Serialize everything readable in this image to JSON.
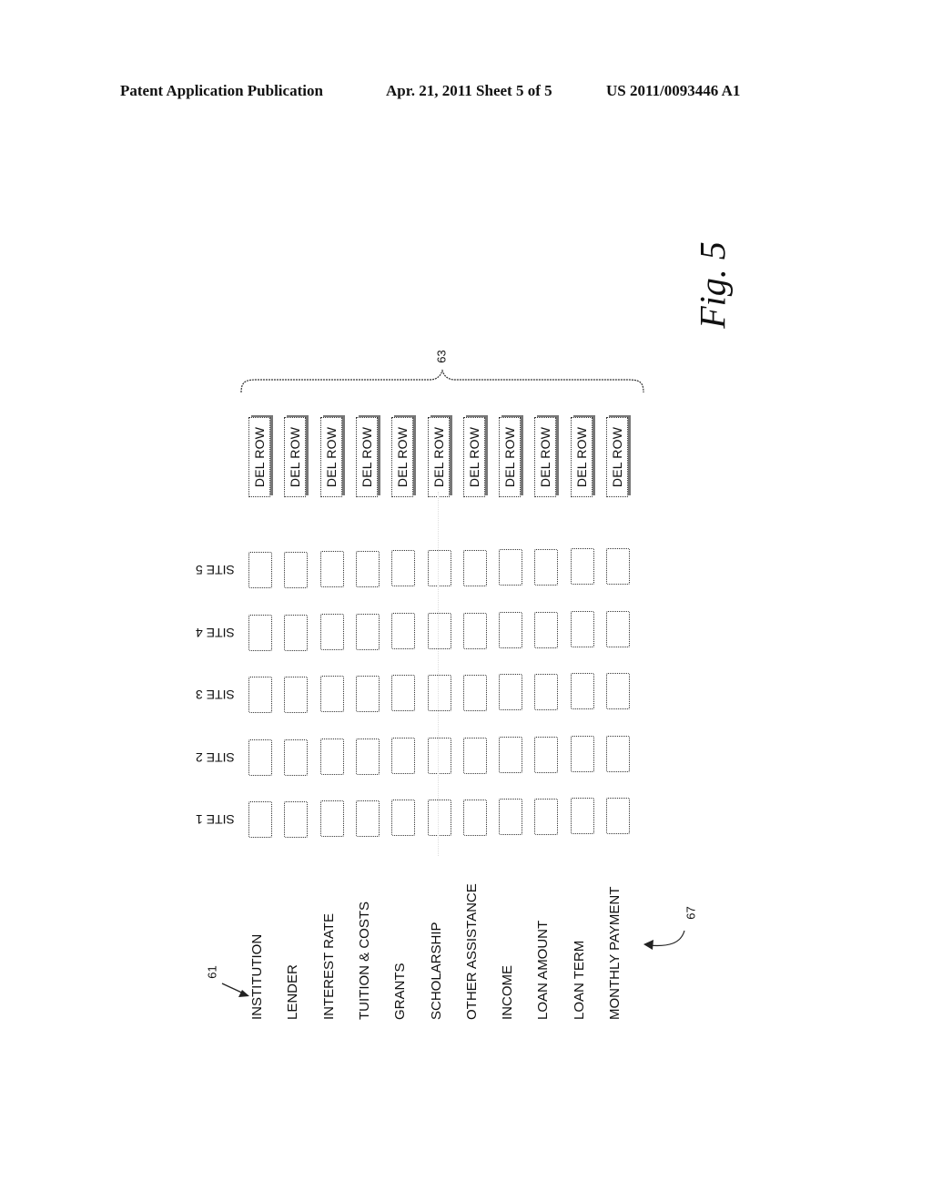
{
  "header": {
    "left": "Patent Application Publication",
    "middle": "Apr. 21, 2011  Sheet 5 of 5",
    "right": "US 2011/0093446 A1"
  },
  "figure": {
    "label": "Fig. 5"
  },
  "references": {
    "rows": "61",
    "buttons": "63",
    "table": "67"
  },
  "delete_button_label": "DEL ROW",
  "sites": [
    "SITE 5",
    "SITE 4",
    "SITE 3",
    "SITE 2",
    "SITE 1"
  ],
  "rows": [
    "INSTITUTION",
    "LENDER",
    "INTEREST RATE",
    "TUITION & COSTS",
    "GRANTS",
    "SCHOLARSHIP",
    "OTHER ASSISTANCE",
    "INCOME",
    "LOAN AMOUNT",
    "LOAN TERM",
    "MONTHLY PAYMENT"
  ]
}
